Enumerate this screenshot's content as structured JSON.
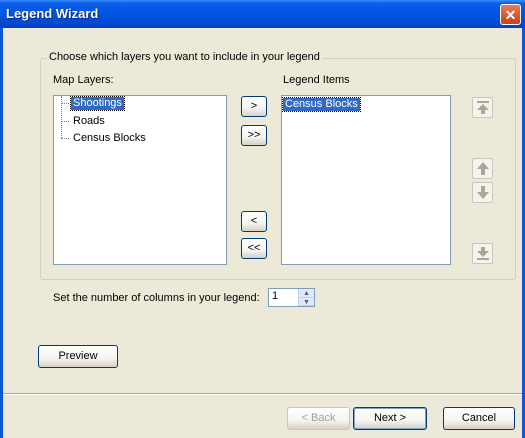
{
  "window": {
    "title": "Legend Wizard",
    "close_icon": "close-x-icon"
  },
  "group": {
    "caption": "Choose which layers you want to include in your legend"
  },
  "map_layers": {
    "label": "Map Layers:",
    "items": [
      "Shootings",
      "Roads",
      "Census Blocks"
    ],
    "selected": "Shootings"
  },
  "transfer_buttons": {
    "add_one": ">",
    "add_all": ">>",
    "remove_one": "<",
    "remove_all": "<<"
  },
  "legend_items": {
    "label": "Legend Items",
    "items": [
      "Census Blocks"
    ],
    "selected": "Census Blocks"
  },
  "order_buttons": {
    "top_icon": "move-to-top-icon",
    "up_icon": "move-up-icon",
    "down_icon": "move-down-icon",
    "bottom_icon": "move-to-bottom-icon"
  },
  "columns": {
    "label": "Set the number of columns in your legend:",
    "value": "1"
  },
  "preview_button": "Preview",
  "footer": {
    "back": "< Back",
    "next": "Next >",
    "cancel": "Cancel"
  }
}
